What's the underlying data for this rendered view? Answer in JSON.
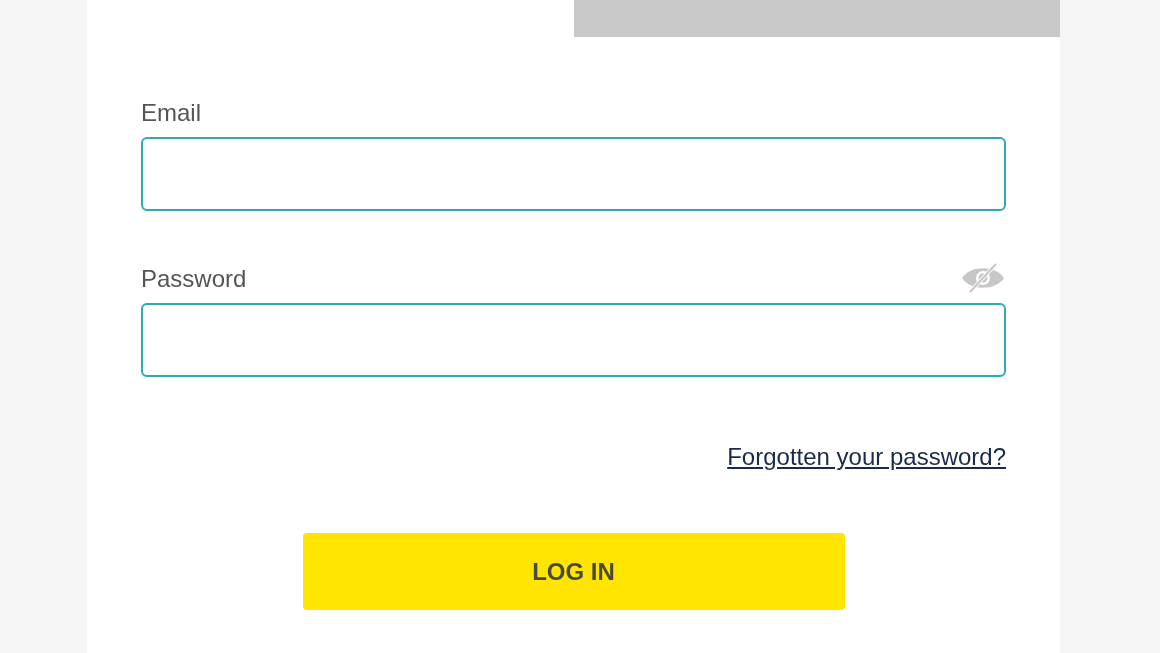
{
  "tabs": [
    {
      "selected": true
    },
    {
      "selected": false
    }
  ],
  "fields": [
    {
      "label": "Email",
      "kind": "text"
    },
    {
      "label": "Password",
      "kind": "password"
    }
  ],
  "forgot_link": "Forgotten your password?",
  "login_button": "LOG IN"
}
